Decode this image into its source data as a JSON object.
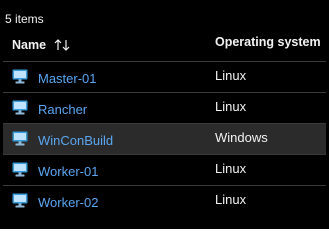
{
  "list": {
    "count_label": "5 items"
  },
  "columns": {
    "name": "Name",
    "os": "Operating system"
  },
  "icons": {
    "sort": "sort-arrows-icon",
    "vm": "virtual-machine-icon"
  },
  "colors": {
    "background": "#000000",
    "link": "#5aa6f0",
    "selected_row": "#2b2b2b",
    "icon_blue": "#3a9bdc"
  },
  "rows": [
    {
      "name": "Master-01",
      "os": "Linux",
      "selected": false
    },
    {
      "name": "Rancher",
      "os": "Linux",
      "selected": false
    },
    {
      "name": "WinConBuild",
      "os": "Windows",
      "selected": true
    },
    {
      "name": "Worker-01",
      "os": "Linux",
      "selected": false
    },
    {
      "name": "Worker-02",
      "os": "Linux",
      "selected": false
    }
  ]
}
